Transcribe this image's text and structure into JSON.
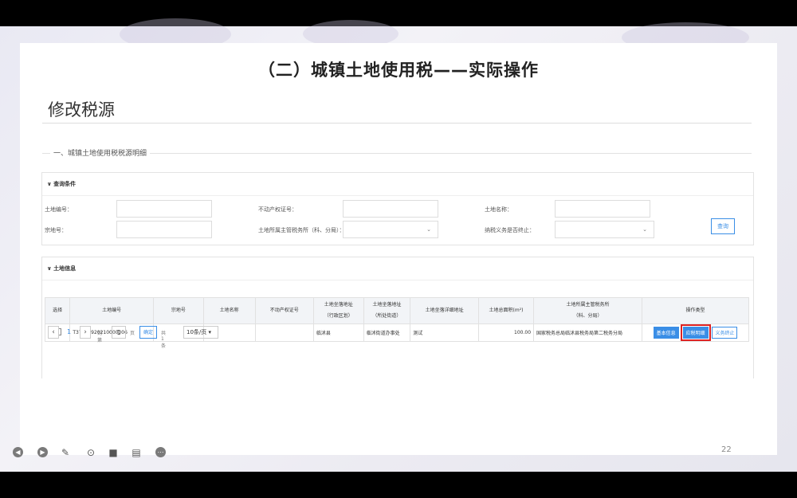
{
  "slide": {
    "title": "（二）城镇土地使用税——实际操作",
    "page_heading": "修改税源",
    "section_label": "一、城镇土地使用税税源明细",
    "slide_number": "22"
  },
  "query_panel": {
    "header": "∨ 查询条件",
    "fields": {
      "land_no_label": "土地编号：",
      "parcel_no_label": "宗地号：",
      "property_cert_label": "不动产权证号：",
      "tax_authority_label": "土地所属主管税务所（科、分局）：",
      "land_name_label": "土地名称：",
      "obligation_end_label": "纳税义务是否终止："
    },
    "query_button": "查询"
  },
  "land_panel": {
    "header": "∨ 土地信息",
    "columns": [
      "选择",
      "土地编号",
      "宗地号",
      "土地名称",
      "不动产权证号",
      "土地坐落地址\n（行政区划）",
      "土地坐落地址\n（所处街道）",
      "土地坐落详细地址",
      "土地总面积(m²)",
      "土地所属主管税务所\n（科、分局）",
      "操作类型"
    ],
    "rows": [
      {
        "land_no": "T37132920210000006",
        "parcel_no": "",
        "land_name": "",
        "property_cert": "",
        "district": "临沭县",
        "street": "临沭街道办事处",
        "address": "测试",
        "area": "100.00",
        "authority": "国家税务总局临沭县税务局第二税务分局",
        "actions": {
          "basic": "基本信息",
          "detail": "应税明细",
          "terminate": "义务终止"
        }
      }
    ]
  },
  "pager": {
    "page": "1",
    "goto_label": "到第",
    "goto_value": "1",
    "page_unit": "页",
    "confirm": "确定",
    "total": "共1条",
    "page_size": "10条/页 ▾"
  },
  "icons": [
    "prev-slide-icon",
    "next-slide-icon",
    "pen-icon",
    "zoom-icon",
    "video-icon",
    "subtitle-icon",
    "more-icon"
  ]
}
